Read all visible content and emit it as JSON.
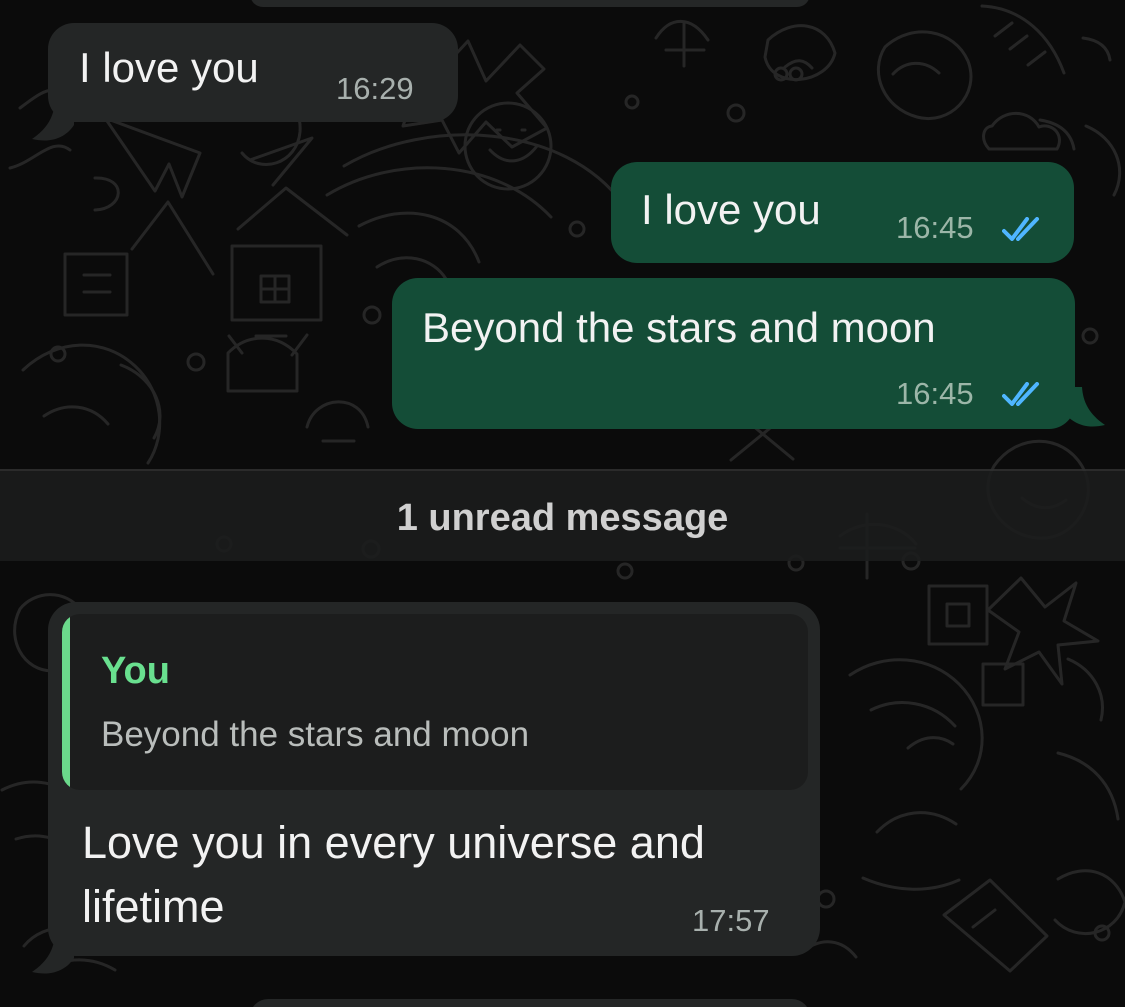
{
  "conversation": {
    "messages": [
      {
        "direction": "incoming",
        "text": "I love you",
        "time": "16:29"
      },
      {
        "direction": "outgoing",
        "text": "I love you",
        "time": "16:45",
        "status": "double-check-read"
      },
      {
        "direction": "outgoing",
        "text": "Beyond the stars and moon",
        "time": "16:45",
        "status": "double-check-read"
      },
      {
        "direction": "incoming",
        "reply_to": {
          "author": "You",
          "text": "Beyond the stars and moon"
        },
        "text": "Love you in every universe and lifetime",
        "time": "17:57"
      }
    ],
    "unread_divider": "1 unread message"
  },
  "colors": {
    "background": "#0b0b0b",
    "incoming_bubble": "#242626",
    "outgoing_bubble": "#144d37",
    "reply_accent": "#69e08f",
    "read_ticks": "#4fb6ff"
  },
  "icons": {
    "read_receipt": "double-check-icon",
    "wallpaper": "doodle-pattern"
  }
}
